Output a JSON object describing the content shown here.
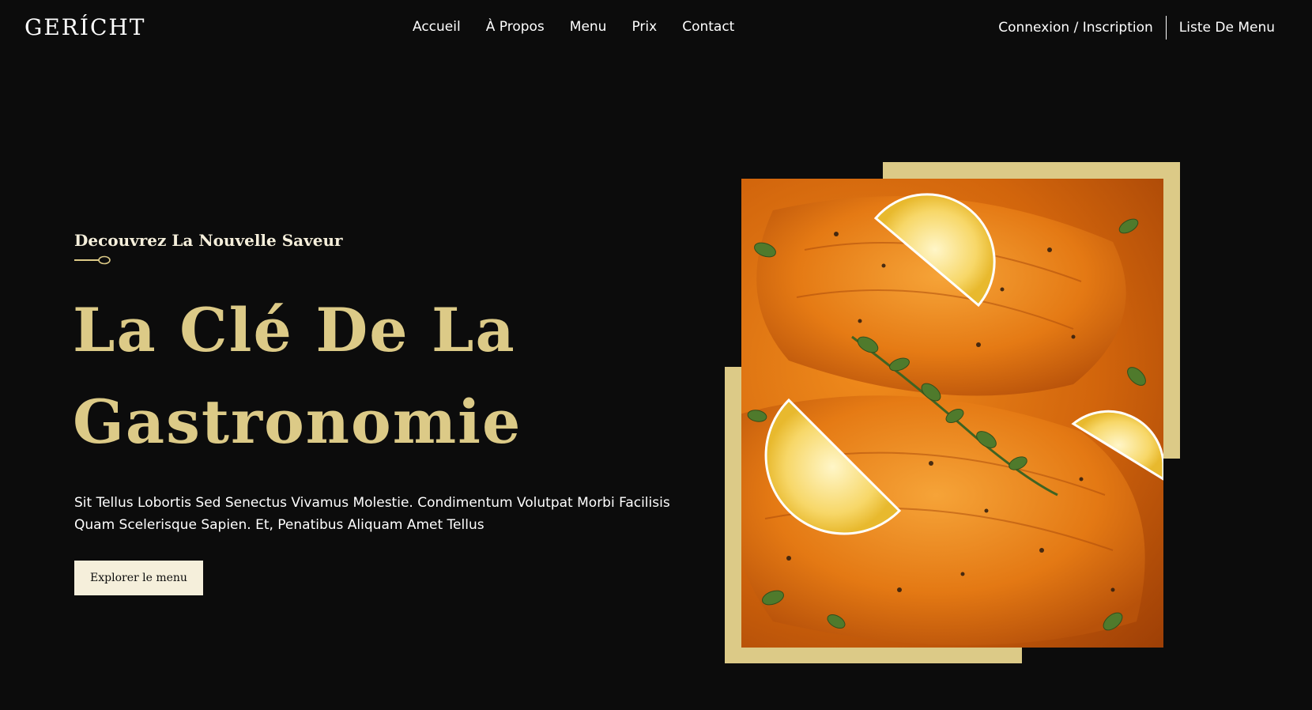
{
  "brand": {
    "logo_text": "GERÍCHT"
  },
  "nav": {
    "links": [
      "Accueil",
      "À Propos",
      "Menu",
      "Prix",
      "Contact"
    ],
    "login_label": "Connexion / Inscription",
    "menu_list_label": "Liste De Menu"
  },
  "hero": {
    "subtitle": "Decouvrez La Nouvelle Saveur",
    "title_line1": "La Clé De La",
    "title_line2": "Gastronomie",
    "paragraph_line1": "Sit Tellus Lobortis Sed Senectus Vivamus Molestie. Condimentum Volutpat Morbi Facilisis",
    "paragraph_line2": "Quam Scelerisque Sapien. Et, Penatibus Aliquam Amet Tellus",
    "button_label": "Explorer le menu",
    "image_icon": "salmon-dish-photo"
  },
  "colors": {
    "background": "#0c0c0c",
    "gold": "#dcca87",
    "cream": "#f5efdb",
    "white": "#ffffff"
  }
}
